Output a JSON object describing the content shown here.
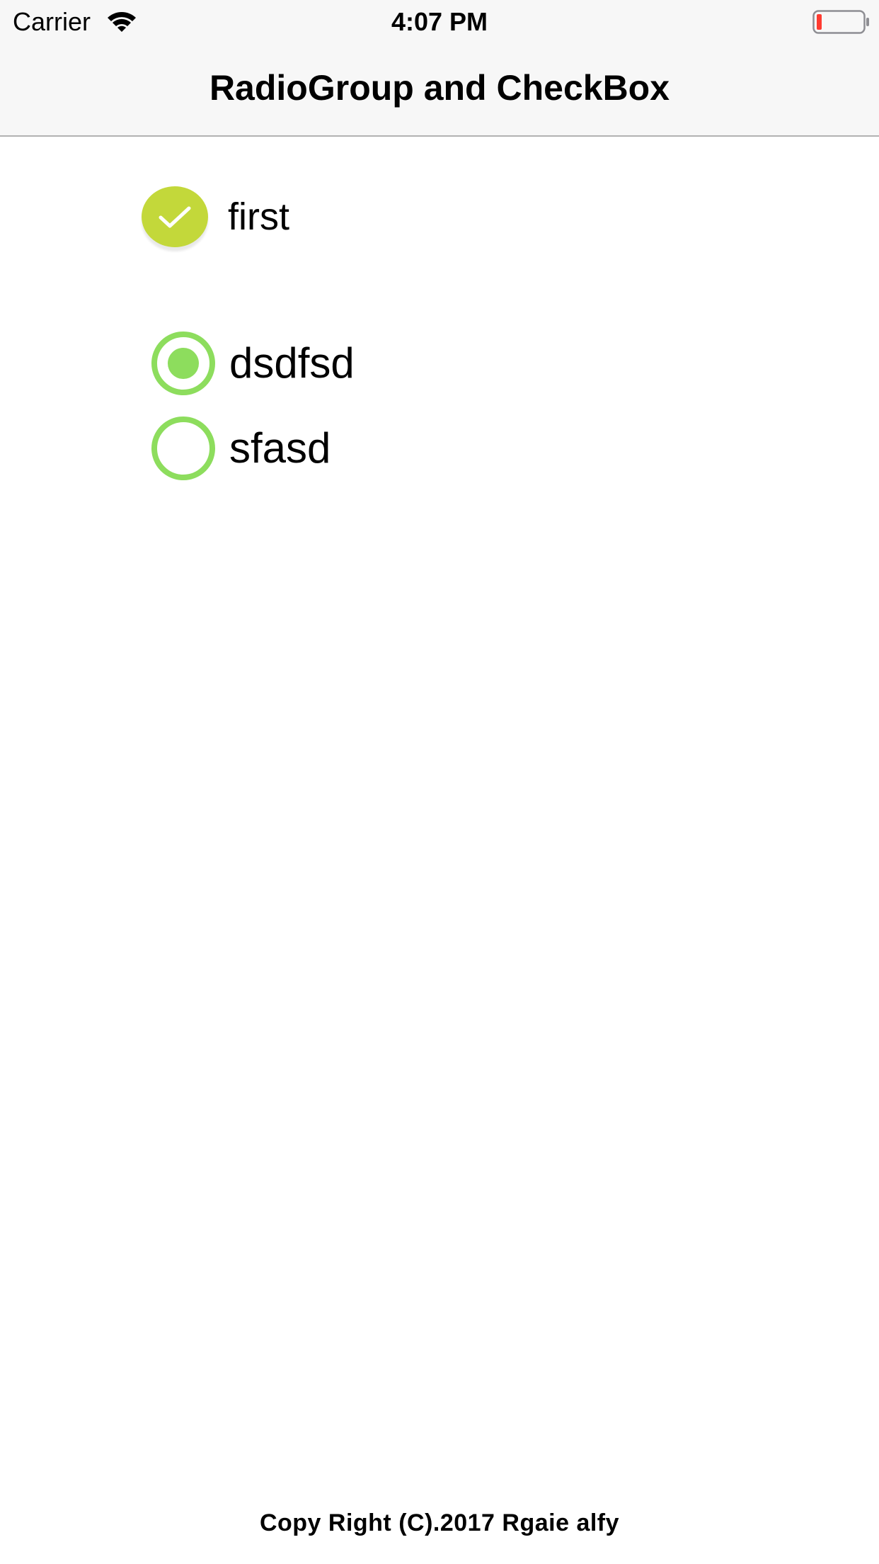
{
  "status_bar": {
    "carrier": "Carrier",
    "time": "4:07 PM",
    "wifi_icon": "wifi-icon",
    "battery_icon": "battery-low-icon"
  },
  "nav": {
    "title": "RadioGroup and CheckBox"
  },
  "checkbox": {
    "label": "first",
    "checked": true,
    "icon": "checkmark-icon"
  },
  "radio_group": {
    "options": [
      {
        "label": "dsdfsd",
        "selected": true
      },
      {
        "label": "sfasd",
        "selected": false
      }
    ]
  },
  "footer": {
    "text": "Copy Right (C).2017 Rgaie alfy"
  },
  "colors": {
    "bar_background": "#f7f7f7",
    "checkbox_fill": "#c3d83a",
    "radio_accent": "#8ddd5d",
    "battery_low": "#ff3b30"
  }
}
